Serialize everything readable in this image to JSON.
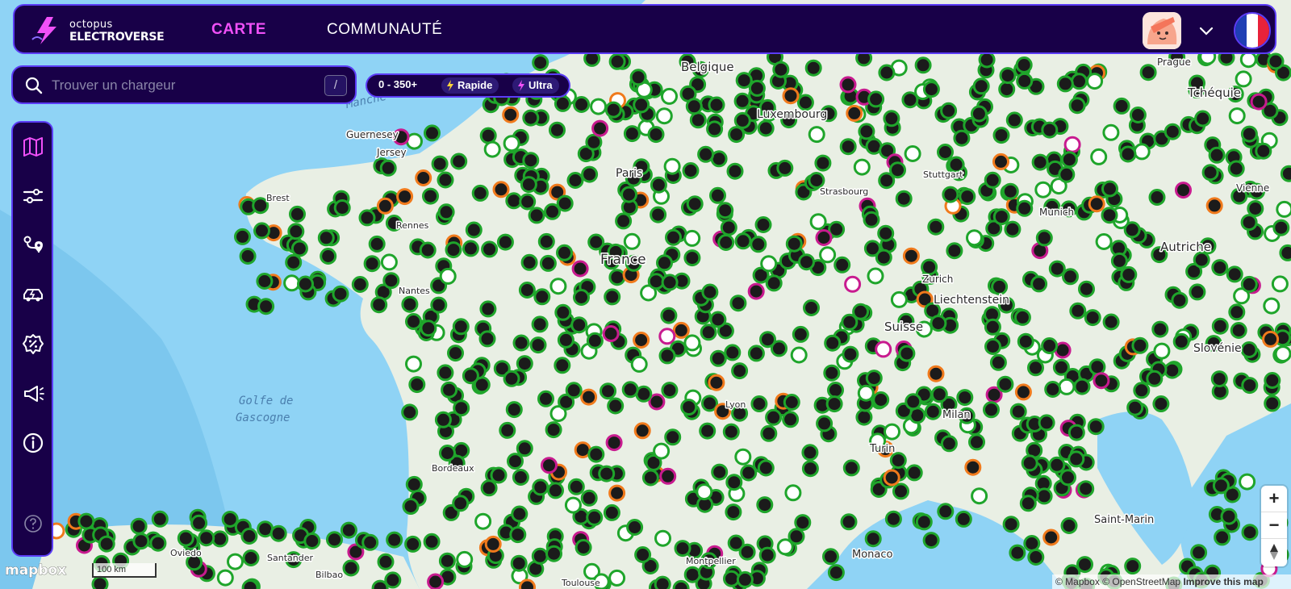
{
  "app": {
    "logo_line1": "octopus",
    "logo_line2": "ELECTROVERSE"
  },
  "nav": {
    "carte": "CARTE",
    "communaute": "COMMUNAUTÉ"
  },
  "search": {
    "placeholder": "Trouver un chargeur",
    "shortcut": "/"
  },
  "filters": {
    "range": "0 - 350+",
    "rapide": "Rapide",
    "ultra": "Ultra"
  },
  "map": {
    "labels": {
      "belgique": "Belgique",
      "luxembourg": "Luxembourg",
      "paris": "Paris",
      "france": "France",
      "suisse": "Suisse",
      "liechtenstein": "Liechtenstein",
      "autriche": "Autriche",
      "slovenie": "Slovénie",
      "tcheque": "Tchéquie",
      "prague": "Prague",
      "vienne": "Vienne",
      "munich": "Munich",
      "stuttgart": "Stuttgart",
      "strasbourg": "Strasbourg",
      "zurich": "Zurich",
      "lyon": "Lyon",
      "bordeaux": "Bordeaux",
      "nantes": "Nantes",
      "rennes": "Rennes",
      "brest": "Brest",
      "milan": "Milan",
      "turin": "Turin",
      "monaco": "Monaco",
      "toulouse": "Toulouse",
      "montpellier": "Montpellier",
      "guernesey": "Guernesey",
      "jersey": "Jersey",
      "santander": "Santander",
      "bilbao": "Bilbao",
      "oviedo": "Oviedo",
      "saint_marin": "Saint-Marin",
      "golfe1": "Golfe de",
      "golfe2": "Gascogne",
      "manche": "Manche"
    },
    "scale": "100 km",
    "attribution_1": "© Mapbox © OpenStreetMap",
    "attribution_2": "Improve this map",
    "mapbox_logo": "mapbox"
  },
  "colors": {
    "nav_bg": "#180048",
    "accent_border": "#5b3df5",
    "accent_pink": "#f050f8",
    "marker_green": "#1fa52b",
    "marker_dark": "#1b1b1b",
    "sea": "#8fd3f5",
    "land": "#e9efe4"
  }
}
